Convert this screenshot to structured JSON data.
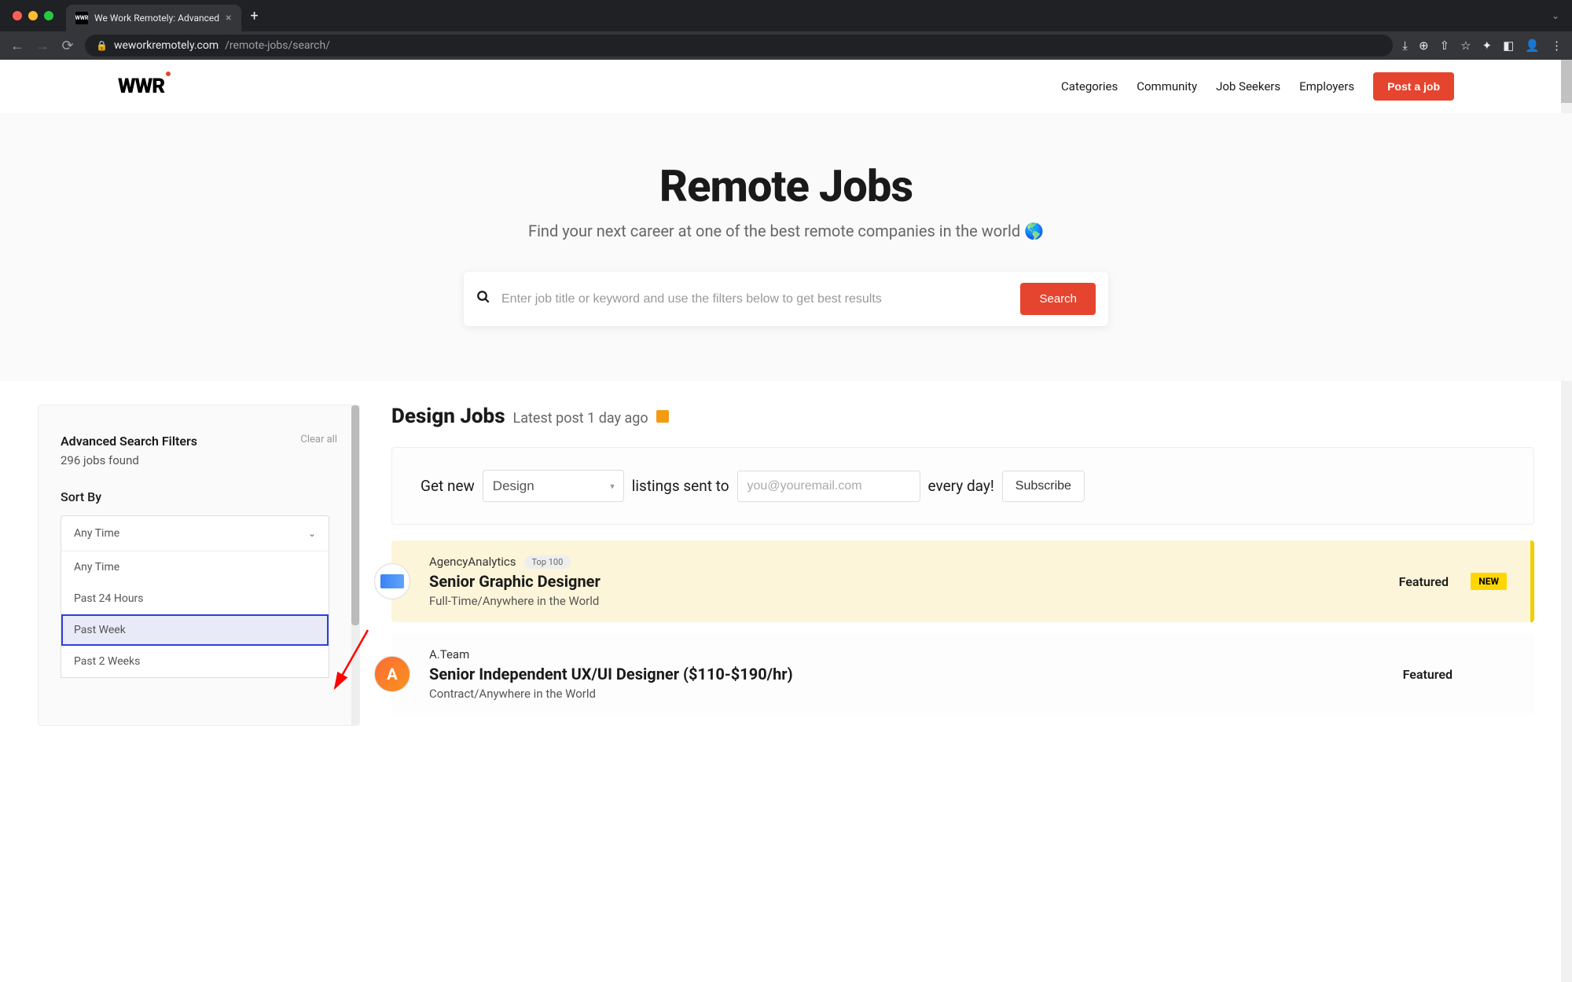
{
  "browser": {
    "tab_title": "We Work Remotely: Advanced",
    "url_host": "weworkremotely.com",
    "url_path": "/remote-jobs/search/"
  },
  "header": {
    "logo": "WWR",
    "nav": [
      "Categories",
      "Community",
      "Job Seekers",
      "Employers"
    ],
    "post_job": "Post a job"
  },
  "hero": {
    "title": "Remote Jobs",
    "subtitle": "Find your next career at one of the best remote companies in the world 🌎",
    "search_placeholder": "Enter job title or keyword and use the filters below to get best results",
    "search_button": "Search"
  },
  "filters": {
    "title": "Advanced Search Filters",
    "clear": "Clear all",
    "found": "296 jobs found",
    "sort_label": "Sort By",
    "sort_selected": "Any Time",
    "sort_options": [
      "Any Time",
      "Past 24 Hours",
      "Past Week",
      "Past 2 Weeks"
    ],
    "highlighted_index": 2
  },
  "results": {
    "title": "Design Jobs",
    "latest": "Latest post 1 day ago"
  },
  "subscribe": {
    "text_before": "Get new",
    "category": "Design",
    "text_mid": "listings sent to",
    "email_placeholder": "you@youremail.com",
    "text_after": "every day!",
    "button": "Subscribe"
  },
  "jobs": [
    {
      "company": "AgencyAnalytics",
      "top100": "Top 100",
      "title": "Senior Graphic Designer",
      "meta": "Full-Time/Anywhere in the World",
      "featured": "Featured",
      "new_badge": "NEW",
      "logo_type": "blue"
    },
    {
      "company": "A.Team",
      "top100": null,
      "title": "Senior Independent UX/UI Designer ($110-$190/hr)",
      "meta": "Contract/Anywhere in the World",
      "featured": "Featured",
      "new_badge": null,
      "logo_type": "orange"
    }
  ]
}
